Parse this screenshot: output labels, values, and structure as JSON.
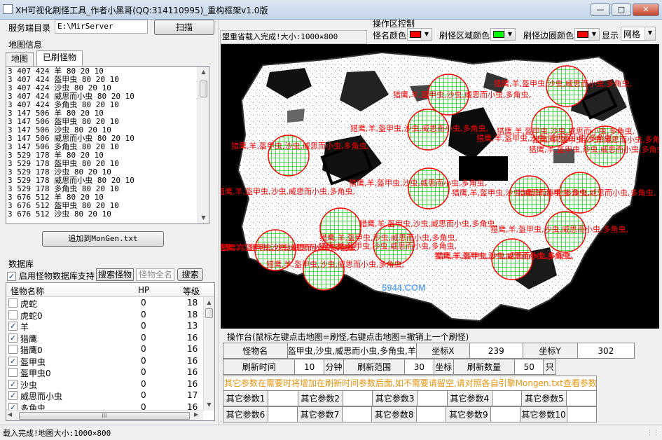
{
  "window": {
    "title": "XH可视化刷怪工具_作者小黑哥(QQ:314110995)_重构框架v1.0版",
    "minimize": "0",
    "maximize": "1",
    "close": "r"
  },
  "server": {
    "label": "服务端目录",
    "path": "E:\\MirServer",
    "scan_button": "扫描"
  },
  "map_info": {
    "group_label": "地图信息",
    "tabs": [
      "地图",
      "已刷怪物"
    ],
    "spawn_lines": [
      "3 407 424 羊 80 20 10",
      "3 407 424 盔甲虫 80 20 10",
      "3 407 424 沙虫 80 20 10",
      "3 407 424 威思而小虫 80 20 10",
      "3 407 424 多角虫 80 20 10",
      "3 147 506 羊 80 20 10",
      "3 147 506 盔甲虫 80 20 10",
      "3 147 506 沙虫 80 20 10",
      "3 147 506 威思而小虫 80 20 10",
      "3 147 506 多角虫 80 20 10",
      "3 529 178 羊 80 20 10",
      "3 529 178 盔甲虫 80 20 10",
      "3 529 178 沙虫 80 20 10",
      "3 529 178 威思而小虫 80 20 10",
      "3 529 178 多角虫 80 20 10",
      "3 676 512 羊 80 20 10",
      "3 676 512 盔甲虫 80 20 10",
      "3 676 512 沙虫 80 20 10"
    ],
    "add_button": "追加到MonGen.txt"
  },
  "database": {
    "group_label": "数据库",
    "enable_label": "启用怪物数据库支持",
    "search_button": "搜索怪物",
    "fullname_label": "怪物全名",
    "search2_button": "搜索",
    "columns": [
      "怪物名称",
      "HP",
      "等级"
    ],
    "rows": [
      {
        "name": "虎蛇",
        "hp": "0",
        "level": "18",
        "checked": false
      },
      {
        "name": "虎蛇0",
        "hp": "0",
        "level": "18",
        "checked": false
      },
      {
        "name": "羊",
        "hp": "0",
        "level": "13",
        "checked": true
      },
      {
        "name": "猎鹰",
        "hp": "0",
        "level": "16",
        "checked": true
      },
      {
        "name": "猎鹰0",
        "hp": "0",
        "level": "16",
        "checked": false
      },
      {
        "name": "盔甲虫",
        "hp": "0",
        "level": "16",
        "checked": true
      },
      {
        "name": "盔甲虫0",
        "hp": "0",
        "level": "16",
        "checked": false
      },
      {
        "name": "沙虫",
        "hp": "0",
        "level": "16",
        "checked": true
      },
      {
        "name": "威思而小虫",
        "hp": "0",
        "level": "17",
        "checked": true
      },
      {
        "name": "多角虫",
        "hp": "0",
        "level": "16",
        "checked": true
      }
    ],
    "hscroll_thumb": "III"
  },
  "controls": {
    "group_label": "操作区控制",
    "name_color_label": "怪名颜色",
    "area_color_label": "刷怪区域颜色",
    "border_color_label": "刷怪边圈颜色",
    "display_label": "显示",
    "display_value": "网格",
    "name_color": "#ff0000",
    "area_color": "#00ff00",
    "border_color": "#ff0000"
  },
  "map_status": "盟重省载入完成!大小:1000×800",
  "map_label_text": "猎鹰,羊,盔甲虫,沙虫,威思而小虫,多角虫,",
  "watermark": "5944.COM",
  "operation": {
    "group_label": "操作台(鼠标左键点击地图=刷怪,右键点击地图=撤销上一个刷怪)",
    "monster_name_label": "怪物名",
    "monster_name_value": "盔甲虫,沙虫,威思而小虫,多角虫,羊",
    "coord_x_label": "坐标X",
    "coord_x_value": "239",
    "coord_y_label": "坐标Y",
    "coord_y_value": "302",
    "refresh_time_label": "刷新时间",
    "refresh_time_value": "10",
    "minutes_unit": "分钟",
    "refresh_range_label": "刷新范围",
    "refresh_range_value": "30",
    "coord_unit": "坐标",
    "refresh_count_label": "刷新数量",
    "refresh_count_value": "50",
    "count_unit": "只",
    "note": "其它参数在需要时将增加在刷新时间参数后面,如不需要请留空,请对照各自引擎Mongen.txt查看参数",
    "params_row1": [
      "其它参数1",
      "其它参数2",
      "其它参数3",
      "其它参数4",
      "其它参数5"
    ],
    "params_row2": [
      "其它参数6",
      "其它参数7",
      "其它参数8",
      "其它参数9",
      "其它参数10"
    ]
  },
  "statusbar": {
    "text": "载入完成!地图大小:1000×800"
  }
}
